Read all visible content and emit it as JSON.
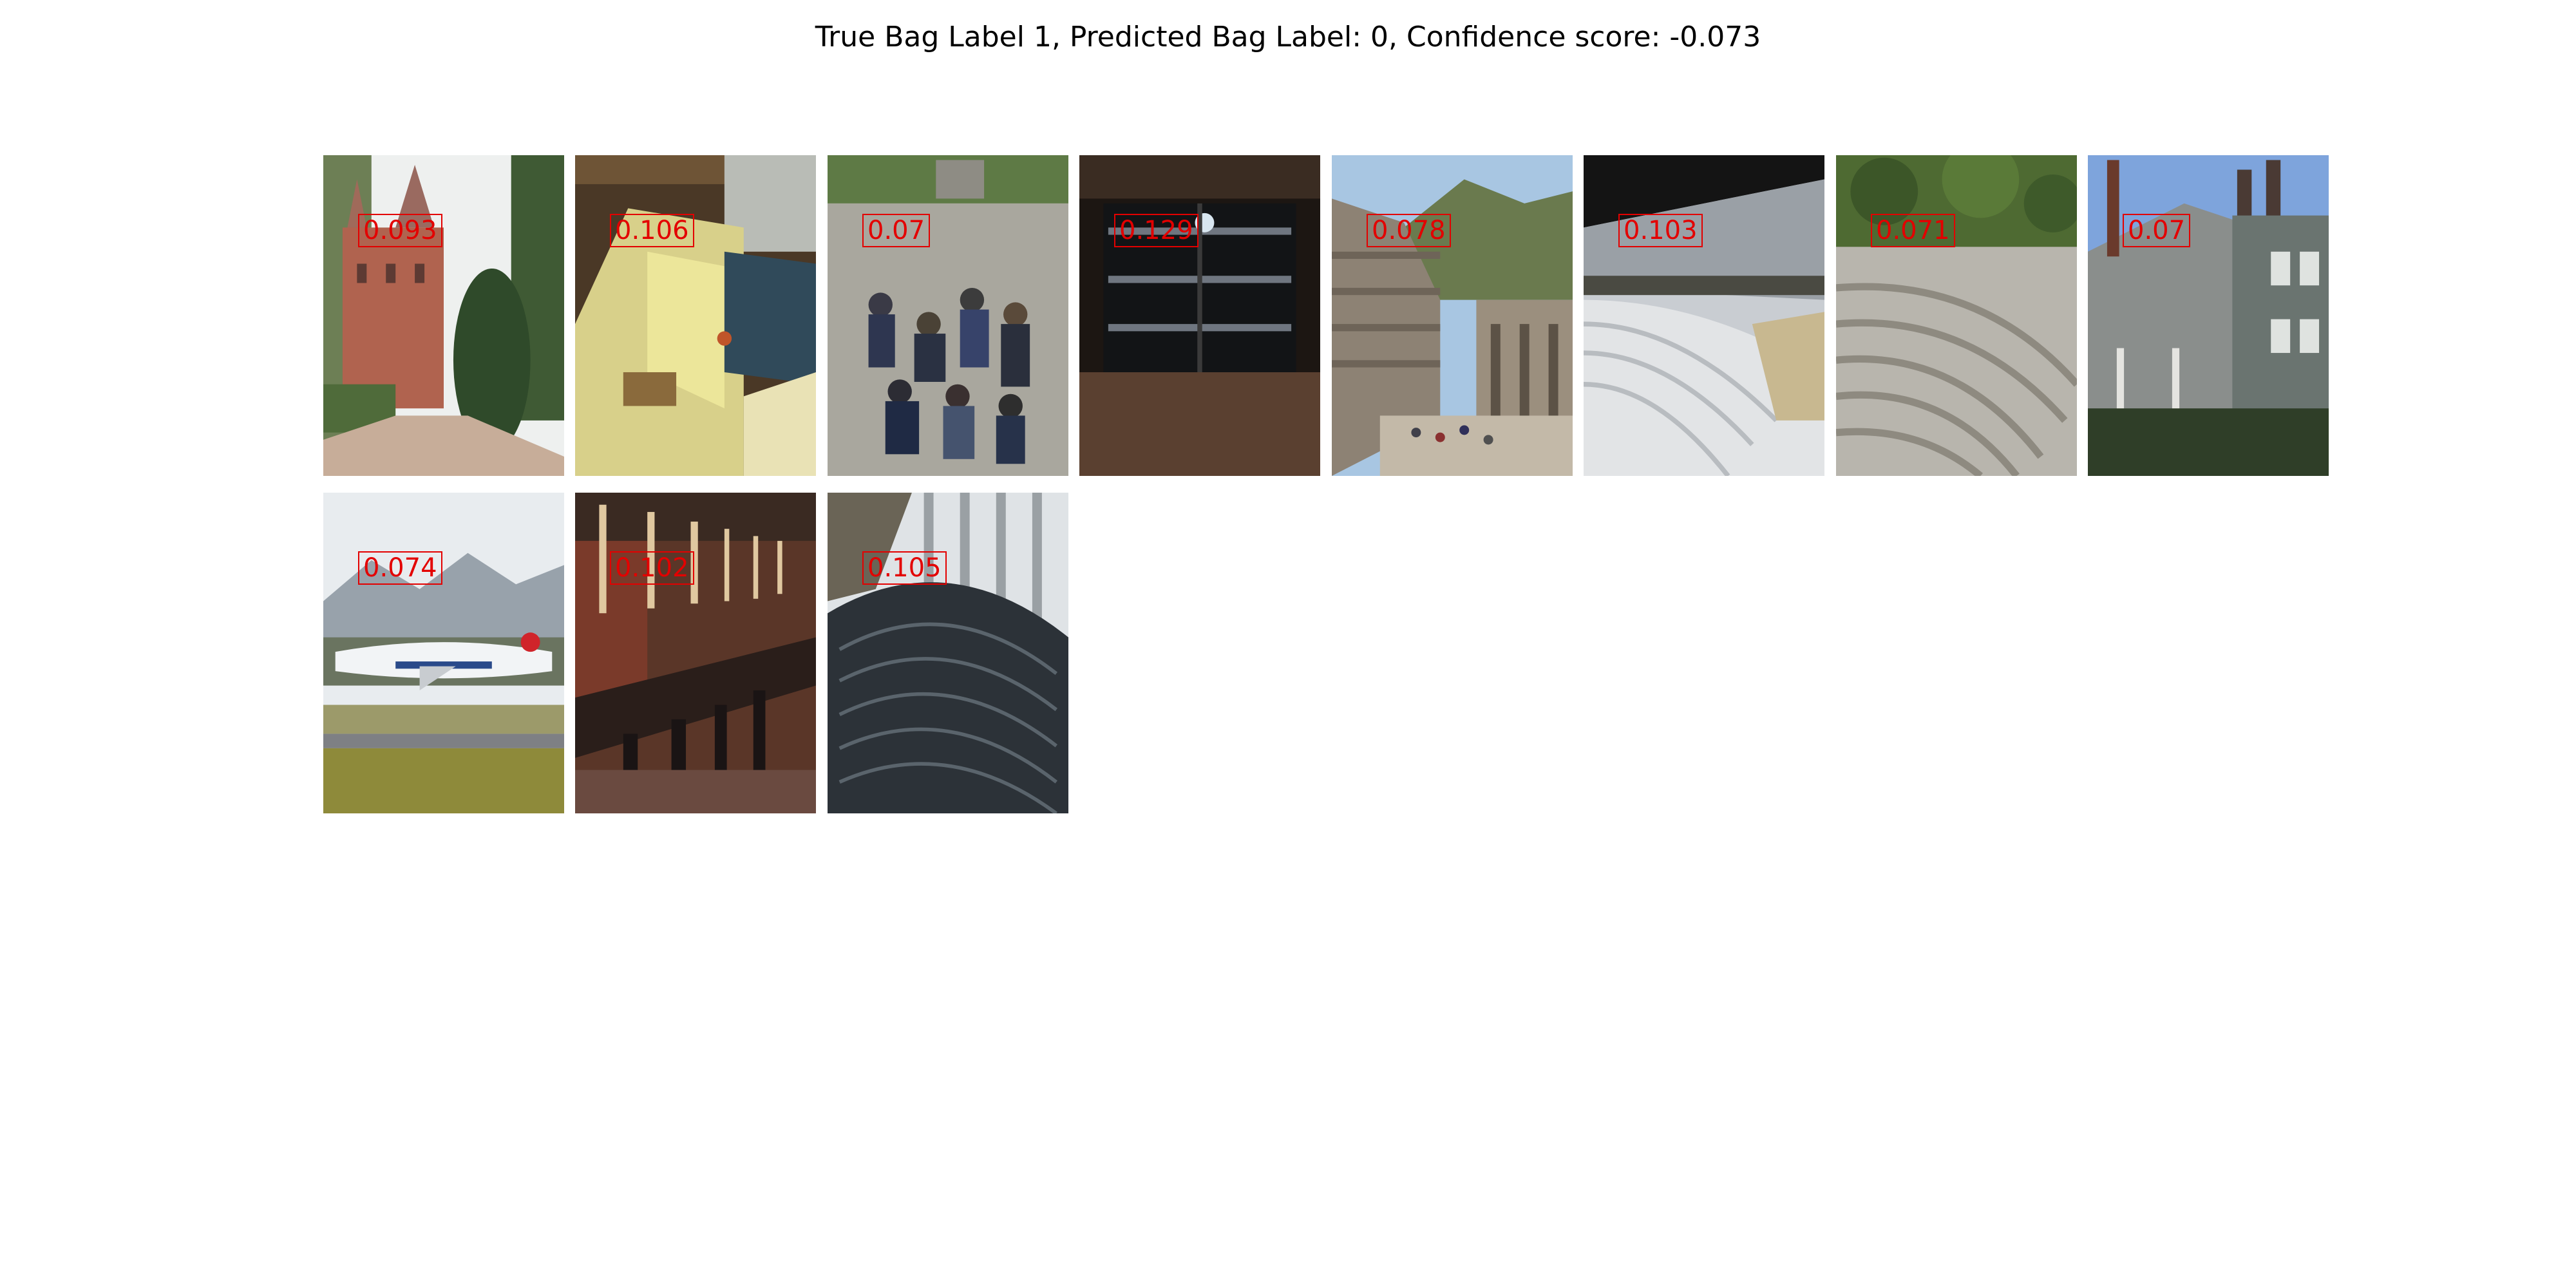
{
  "figure": {
    "title": "True Bag Label 1, Predicted Bag Label: 0, Confidence score: -0.073"
  },
  "colors": {
    "score_color": "#e30000",
    "background": "#ffffff"
  },
  "instances": [
    {
      "scene": "castle-garden",
      "score": "0.093"
    },
    {
      "scene": "interior-desk",
      "score": "0.106"
    },
    {
      "scene": "people-plaza",
      "score": "0.07"
    },
    {
      "scene": "dark-cabinet",
      "score": "0.129"
    },
    {
      "scene": "amphitheater-crowd",
      "score": "0.078"
    },
    {
      "scene": "stadium-seats",
      "score": "0.103"
    },
    {
      "scene": "stone-theater",
      "score": "0.071"
    },
    {
      "scene": "house-exterior",
      "score": "0.07"
    },
    {
      "scene": "airplane-runway",
      "score": "0.074"
    },
    {
      "scene": "restaurant-bar",
      "score": "0.102"
    },
    {
      "scene": "whale-hall",
      "score": "0.105"
    }
  ]
}
